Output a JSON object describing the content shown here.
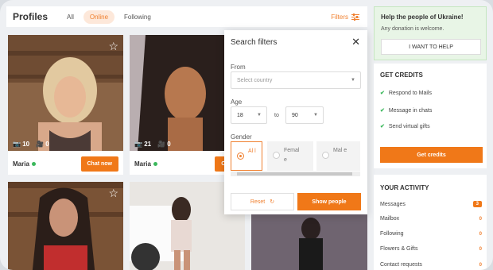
{
  "header": {
    "title": "Profiles",
    "tabs": [
      {
        "label": "All",
        "active": false
      },
      {
        "label": "Online",
        "active": true
      },
      {
        "label": "Following",
        "active": false
      }
    ],
    "filters_label": "Filters",
    "filters_icon": "sliders-icon"
  },
  "profiles": [
    {
      "name": "Maria",
      "online": true,
      "photos": "10",
      "videos": "0",
      "chat_label": "Chat now"
    },
    {
      "name": "Maria",
      "online": true,
      "photos": "21",
      "videos": "0",
      "chat_label": "Chat n"
    },
    {
      "name": "",
      "online": false,
      "photos": "",
      "videos": "",
      "chat_label": ""
    },
    {
      "name": "",
      "online": false,
      "photos": "",
      "videos": "",
      "chat_label": ""
    },
    {
      "name": "",
      "online": false,
      "photos": "",
      "videos": "",
      "chat_label": ""
    }
  ],
  "filter_panel": {
    "title": "Search filters",
    "from_label": "From",
    "country_placeholder": "Select country",
    "age_label": "Age",
    "age_from": "18",
    "age_separator": "to",
    "age_to": "90",
    "gender_label": "Gender",
    "gender_options": [
      {
        "label": "Al l",
        "selected": true
      },
      {
        "label": "Femal e",
        "selected": false
      },
      {
        "label": "Mal e",
        "selected": false
      }
    ],
    "reset_label": "Reset",
    "show_label": "Show people"
  },
  "ukraine": {
    "heading": "Help the people of Ukraine!",
    "subtext": "Any donation is welcome.",
    "button": "I WANT TO HELP"
  },
  "credits": {
    "title": "GET CREDITS",
    "items": [
      "Respond to Mails",
      "Message in chats",
      "Send virtual gifts"
    ],
    "button": "Get credits"
  },
  "activity": {
    "title": "YOUR ACTIVITY",
    "rows": [
      {
        "label": "Messages",
        "value": "3",
        "badge": true
      },
      {
        "label": "Mailbox",
        "value": "0",
        "badge": false
      },
      {
        "label": "Following",
        "value": "0",
        "badge": false
      },
      {
        "label": "Flowers & Gifts",
        "value": "0",
        "badge": false
      },
      {
        "label": "Contact requests",
        "value": "0",
        "badge": false
      }
    ]
  },
  "colors": {
    "accent": "#f07818",
    "online": "#3bb85c",
    "donation_bg": "#e8f5e6"
  }
}
